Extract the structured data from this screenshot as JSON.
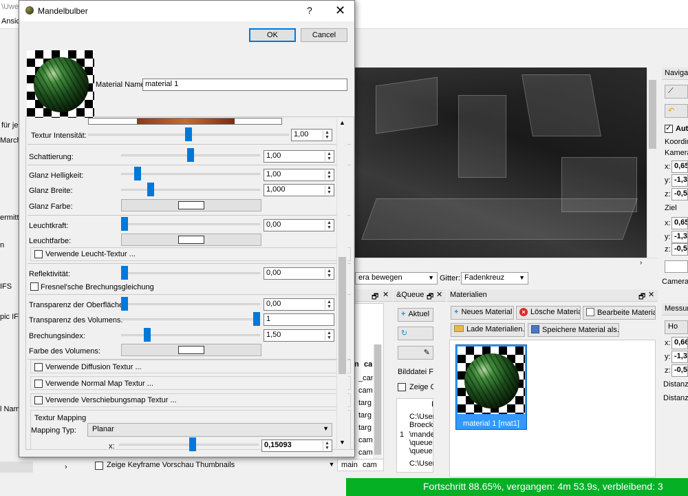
{
  "bg": {
    "title_frag": "\\Uwe",
    "menu_frag": "Ansich",
    "left_labels": {
      "fur_je": "für je",
      "marchi": "Marchi",
      "ermittl": "ermittl",
      "n": "n",
      "ifs": "IFS",
      "pic_ifs": "pic IFS",
      "name": "l Name"
    },
    "navigation_hdr": "Navigati",
    "auto_label": "Aut",
    "koordinaten": "Koordina",
    "kamera": "Kamera",
    "ziel": "Ziel",
    "camera_r": "Camera r",
    "messung": "Messun",
    "ho_btn": "Ho",
    "distanz1": "Distanz",
    "distanz2": "Distanz",
    "cam_fields": [
      "0,65",
      "-1,3",
      "-0,56"
    ],
    "ziel_fields": [
      "0,65",
      "-1,3",
      "-0,56"
    ],
    "mess_fields": [
      "0,66",
      "-1,3",
      "-0,5"
    ],
    "axes": [
      "x:",
      "y:",
      "z:"
    ],
    "camera_mode": "era bewegen",
    "gitter_label": "Gitter:",
    "gitter_value": "Fadenkreuz",
    "queue_hdr": "&Queue",
    "queue_btn1": "Aktuel",
    "bilddatei": "Bilddatei Fo",
    "zeige_q": "Zeige Q",
    "queue_path": [
      "C:\\User",
      "Broecke",
      "\\mande",
      "\\queue",
      "\\queue",
      "C:\\User"
    ],
    "queue_row_num": "1",
    "list_col1": "n",
    "list_col2": "ca",
    "list_rows": [
      "_cam",
      "cam",
      "targ",
      "targ",
      "targ",
      "cam",
      "cam"
    ],
    "list_main": "main",
    "list_cam": "cam",
    "zeige_keyframe": "Zeige Keyframe Vorschau Thumbnails",
    "materialien_hdr": "Materialien",
    "btn_neues": "Neues Material",
    "btn_loesche": "Lösche Material",
    "btn_bearbeite": "Bearbeite Material",
    "btn_lade": "Lade Materialien...",
    "btn_speichere": "Speichere Material als...",
    "mat_item_label": "material 1 [mat1]",
    "progress": "Fortschritt 88.65%, vergangen: 4m 53.9s, verbleibend: 3"
  },
  "dialog": {
    "title": "Mandelbulber",
    "help": "?",
    "close": "✕",
    "ok": "OK",
    "cancel": "Cancel",
    "material_name_label": "Material Name:",
    "material_name_value": "material 1",
    "rows": {
      "textur_intensitaet": {
        "label": "Textur Intensität:",
        "value": "1,00",
        "level": 0.5
      },
      "schattierung": {
        "label": "Schattierung:",
        "value": "1,00",
        "level": 0.5
      },
      "glanz_helligkeit": {
        "label": "Glanz Helligkeit:",
        "value": "1,00",
        "level": 0.1
      },
      "glanz_breite": {
        "label": "Glanz Breite:",
        "value": "1,000",
        "level": 0.2
      },
      "glanz_farbe": {
        "label": "Glanz Farbe:"
      },
      "leuchtkraft": {
        "label": "Leuchtkraft:",
        "value": "0,00",
        "level": 0.0
      },
      "leuchtfarbe": {
        "label": "Leuchtfarbe:"
      },
      "verwende_leucht": {
        "label": "Verwende Leucht-Textur ..."
      },
      "reflektivitaet": {
        "label": "Reflektivität:",
        "value": "0,00",
        "level": 0.0
      },
      "fresnel": {
        "label": "Fresnel'sche Brechungsgleichung"
      },
      "transparenz_oberflaeche": {
        "label": "Transparenz der Oberfläche:",
        "value": "0,00",
        "level": 0.0
      },
      "transparenz_volumen": {
        "label": "Transparenz des Volumens:",
        "value": "1",
        "level": 1.0
      },
      "brechungsindex": {
        "label": "Brechungsindex:",
        "value": "1,50",
        "level": 0.17
      },
      "farbe_volumen": {
        "label": "Farbe des Volumens:"
      },
      "diffusion": {
        "label": "Verwende Diffusion Textur ..."
      },
      "normal_map": {
        "label": "Verwende Normal Map Textur ..."
      },
      "verschiebung": {
        "label": "Verwende Verschiebungsmap Textur ..."
      },
      "textur_mapping": {
        "label": "Textur Mapping"
      },
      "mapping_typ": {
        "label": "Mapping Typ:",
        "value": "Planar"
      },
      "mapping_x": {
        "label": "x:",
        "value": "0,15093",
        "level": 0.53
      }
    }
  }
}
